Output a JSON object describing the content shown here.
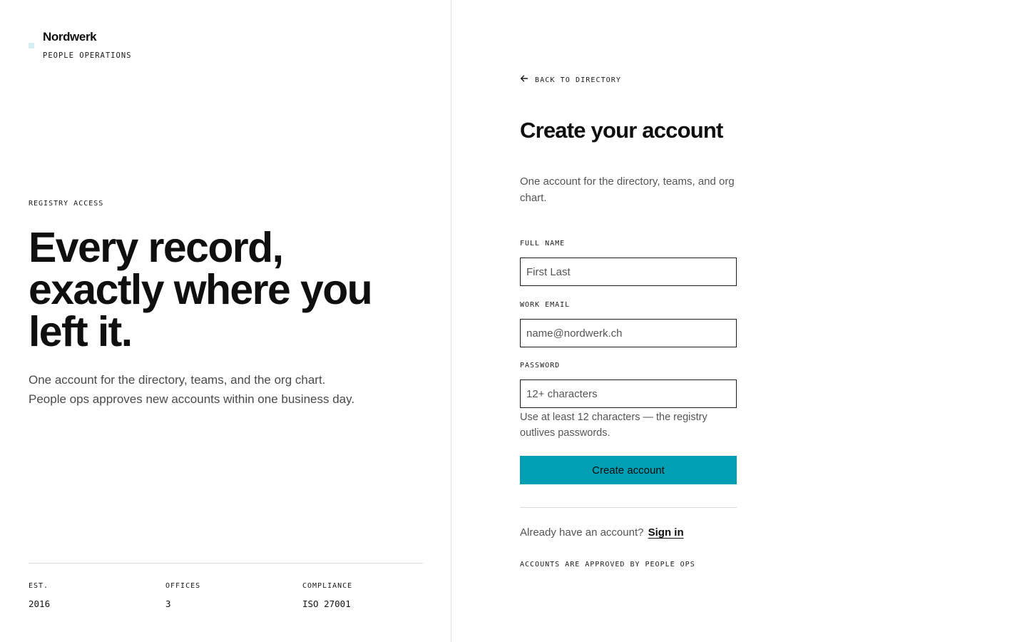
{
  "brand": {
    "name": "Nordwerk",
    "subtitle": "PEOPLE OPERATIONS",
    "mark_color": "#d6eef3"
  },
  "hero": {
    "eyebrow": "REGISTRY ACCESS",
    "headline": "Every record, exactly where you left it.",
    "copy": "One account for the directory, teams, and the org chart. People ops approves new accounts within one business day."
  },
  "stats": [
    {
      "label": "EST.",
      "value": "2016"
    },
    {
      "label": "OFFICES",
      "value": "3"
    },
    {
      "label": "COMPLIANCE",
      "value": "ISO 27001"
    }
  ],
  "form": {
    "back_label": "BACK TO DIRECTORY",
    "back_icon": "arrow-left-icon",
    "title": "Create your account",
    "subtitle": "One account for the directory, teams, and org chart.",
    "fields": {
      "full_name": {
        "label": "FULL NAME",
        "placeholder": "First Last",
        "value": ""
      },
      "work_email": {
        "label": "WORK EMAIL",
        "placeholder": "name@nordwerk.ch",
        "value": ""
      },
      "password": {
        "label": "PASSWORD",
        "placeholder": "12+ characters",
        "value": ""
      }
    },
    "password_hint": "Use at least 12 characters — the registry outlives passwords.",
    "submit_label": "Create account",
    "signin_prompt": "Already have an account?",
    "signin_link": "Sign in",
    "approval_note": "ACCOUNTS ARE APPROVED BY PEOPLE OPS"
  },
  "colors": {
    "accent": "#009fb4",
    "text": "#111111",
    "muted": "#555555",
    "border": "#dcdcdc"
  }
}
